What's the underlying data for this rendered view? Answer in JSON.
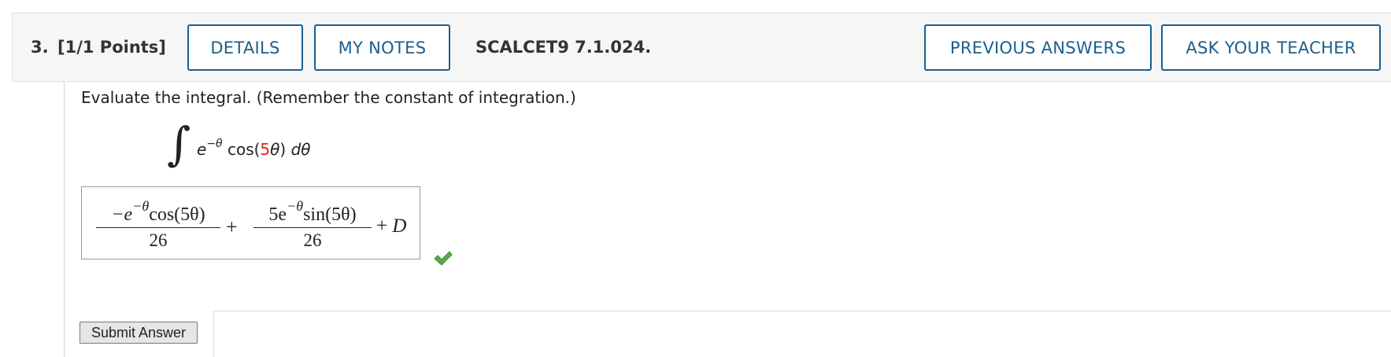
{
  "question": {
    "number": "3.",
    "points": "[1/1 Points]",
    "code": "SCALCET9 7.1.024."
  },
  "buttons": {
    "details": "DETAILS",
    "my_notes": "MY NOTES",
    "previous_answers": "PREVIOUS ANSWERS",
    "ask_teacher": "ASK YOUR TEACHER",
    "submit": "Submit Answer"
  },
  "problem": {
    "instructions": "Evaluate the integral. (Remember the constant of integration.)",
    "integral_sign": "∫",
    "integrand_base": "e",
    "integrand_exponent": "−θ",
    "integrand_func_open": " cos(",
    "integrand_coeff": "5",
    "integrand_var": "θ",
    "integrand_func_close": ") ",
    "integrand_diff": "dθ"
  },
  "answer": {
    "frac1_prefix": "−e",
    "frac1_exponent": "−θ",
    "frac1_rest": "cos(5θ)",
    "frac1_den": "26",
    "plus": "+",
    "frac2_prefix": "5e",
    "frac2_exponent": "−θ",
    "frac2_rest": "sin(5θ)",
    "frac2_den": "26",
    "tail_plus": "+",
    "tail_constant": "D",
    "status_icon": "check-icon",
    "status_color": "#5aa84a"
  },
  "colors": {
    "accent": "#1c5e8c",
    "highlight": "#e02020"
  }
}
